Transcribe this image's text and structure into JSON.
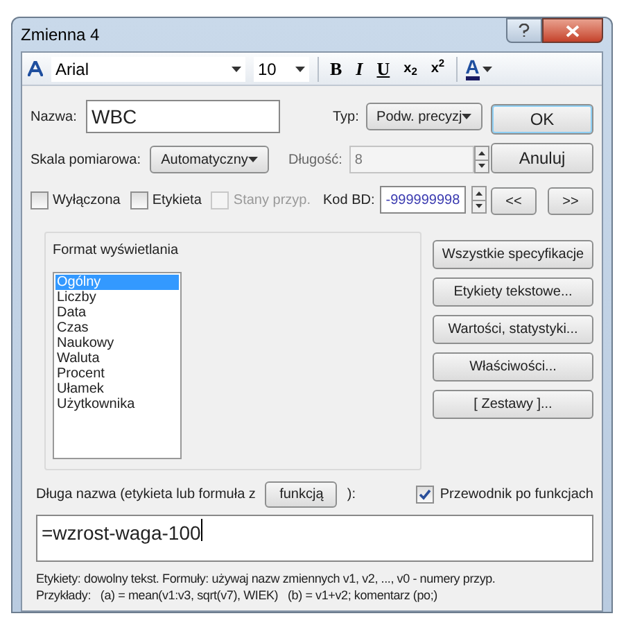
{
  "window": {
    "title": "Zmienna 4"
  },
  "toolbar": {
    "font": "Arial",
    "size": "10",
    "bold": "B",
    "italic": "I",
    "underline": "U",
    "subscript": "x$_{2}$",
    "superscript": "x$^{2}$",
    "text_color": "A"
  },
  "name": {
    "label": "Nazwa:",
    "value": "WBC"
  },
  "type": {
    "label": "Typ:",
    "value": "Podw. precyzj"
  },
  "scale": {
    "label": "Skala pomiarowa:",
    "value": "Automatyczny"
  },
  "length": {
    "label": "Długość:",
    "value": "8",
    "disabled": true
  },
  "checkboxes": [
    {
      "label": "Wyłączona",
      "checked": false,
      "disabled": false
    },
    {
      "label": "Etykieta",
      "checked": false,
      "disabled": false
    },
    {
      "label": "Stany przyp.",
      "checked": false,
      "disabled": true
    }
  ],
  "missing_code": {
    "label": "Kod BD:",
    "value": "-999999998"
  },
  "dialog_buttons": [
    "OK",
    "Anuluj"
  ],
  "nav_buttons": [
    "<<",
    ">>"
  ],
  "format": {
    "title": "Format wyświetlania",
    "items": [
      {
        "label": "Ogólny",
        "selected": true
      },
      {
        "label": "Liczby",
        "selected": false
      },
      {
        "label": "Data",
        "selected": false
      },
      {
        "label": "Czas",
        "selected": false
      },
      {
        "label": "Naukowy",
        "selected": false
      },
      {
        "label": "Waluta",
        "selected": false
      },
      {
        "label": "Procent",
        "selected": false
      },
      {
        "label": "Ułamek",
        "selected": false
      },
      {
        "label": "Użytkownika",
        "selected": false
      }
    ]
  },
  "side_buttons": [
    "Wszystkie specyfikacje",
    "Etykiety tekstowe...",
    "Wartości, statystyki...",
    "Właściwości...",
    "[ Zestawy ]..."
  ],
  "long_name": {
    "label_before": "Długa nazwa (etykieta lub formuła z",
    "button": "funkcją",
    "label_after": "):",
    "wizard": {
      "label": "Przewodnik po funkcjach",
      "checked": true
    },
    "value": "=wzrost-waga-100"
  },
  "help": [
    "Etykiety: dowolny tekst. Formuły: używaj nazw zmiennych v1, v2, ..., v0 - numery przyp.",
    "Przykłady:   (a) = mean(v1:v3, sqrt(v7), WIEK)   (b) = v1+v2; komentarz (po;)"
  ]
}
